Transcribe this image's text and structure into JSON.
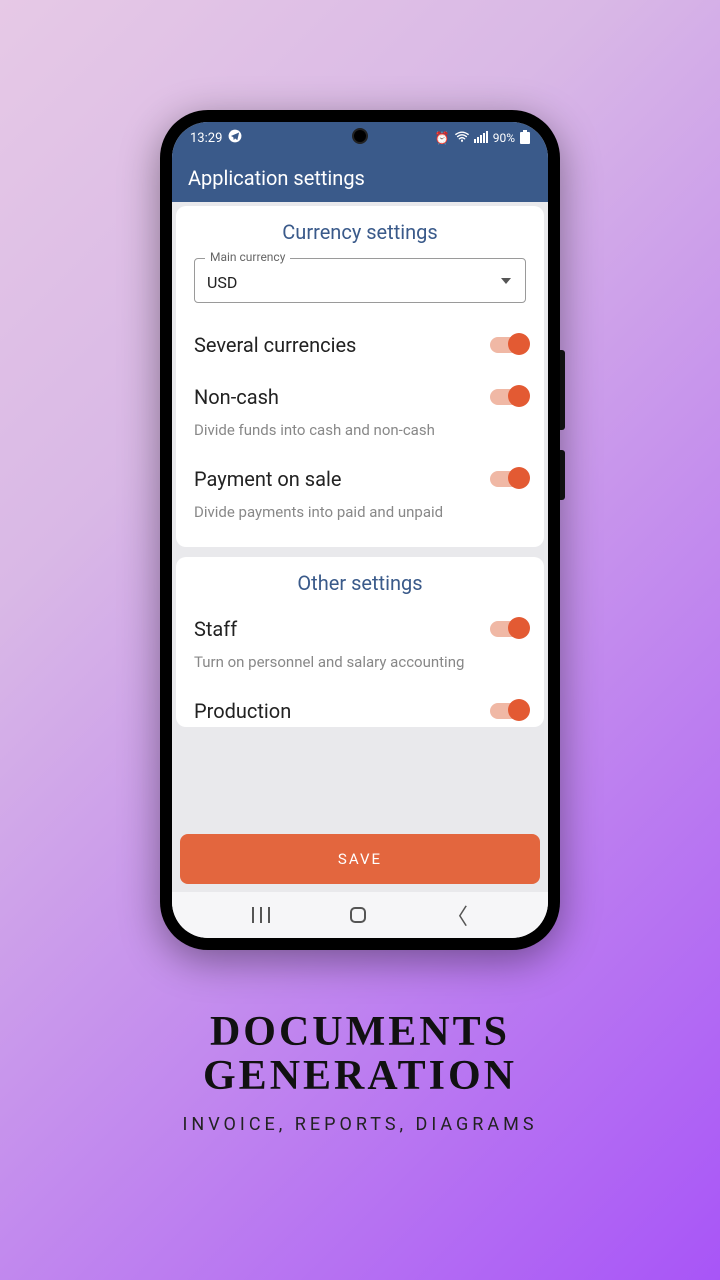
{
  "status": {
    "time": "13:29",
    "battery": "90%"
  },
  "appbar": {
    "title": "Application settings"
  },
  "currency": {
    "section_title": "Currency settings",
    "dropdown_label": "Main currency",
    "dropdown_value": "USD",
    "several": {
      "label": "Several currencies"
    },
    "noncash": {
      "label": "Non-cash",
      "desc": "Divide funds into cash and non-cash"
    },
    "payment": {
      "label": "Payment on sale",
      "desc": "Divide payments into paid and unpaid"
    }
  },
  "other": {
    "section_title": "Other settings",
    "staff": {
      "label": "Staff",
      "desc": "Turn on personnel and salary accounting"
    },
    "production": {
      "label": "Production"
    }
  },
  "save_label": "SAVE",
  "promo": {
    "title_line1": "DOCUMENTS",
    "title_line2": "GENERATION",
    "subtitle": "INVOICE, REPORTS, DIAGRAMS"
  }
}
